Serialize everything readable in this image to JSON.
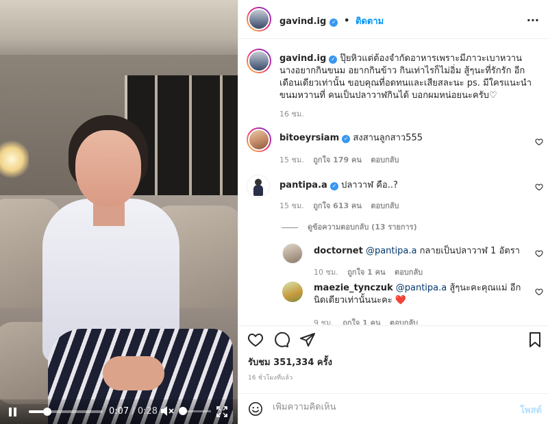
{
  "video": {
    "current_time": "0:07",
    "separator": "/",
    "duration": "0:28",
    "progress_fraction": 0.25,
    "volume_fraction": 0.0
  },
  "header": {
    "username": "gavind.ig",
    "separator": "•",
    "follow_label": "ติดตาม",
    "more_label": "···"
  },
  "caption": {
    "username": "gavind.ig",
    "text": "ปุ๊ยหิวแต่ต้องจำกัดอาหารเพราะมีภาวะเบาหวาน นางอยากกินขนม อยากกินข้าว กินเท่าไรก็ไม่อิ่ม สู้ๆนะที่รักรัก อีกเดือนเดียวเท่านั้น ขอบคุณที่อดทนและเสียสละนะ ps. มีใครแนะนำขนมหวานที่ คนเป็นปลาวาฬกินได้ บอกผมหน่อยนะครับ♡",
    "time": "16 ชม."
  },
  "comments": [
    {
      "username": "bitoeyrsiam",
      "verified": true,
      "text": "สงสานลูกสาว555",
      "time": "15 ชม.",
      "likes": "ถูกใจ 179 คน",
      "reply_label": "ตอบกลับ"
    },
    {
      "username": "pantipa.a",
      "verified": true,
      "text": "ปลาวาฬ คือ..?",
      "time": "15 ชม.",
      "likes": "ถูกใจ 613 คน",
      "reply_label": "ตอบกลับ"
    }
  ],
  "view_replies_label": "ดูข้อความตอบกลับ (13 รายการ)",
  "replies": [
    {
      "username": "doctornet",
      "mention": "@pantipa.a",
      "text": "กลายเป็นปลาวาฬ 1 อัตรา",
      "time": "10 ชม.",
      "likes": "ถูกใจ 1 คน",
      "reply_label": "ตอบกลับ"
    },
    {
      "username": "maezie_tynczuk",
      "mention": "@pantipa.a",
      "text": "สู้ๆนะคะคุณแม่ อีกนิดเดียวเท่านั้นนะคะ ❤️",
      "time": "9 ชม.",
      "likes": "ถูกใจ 1 คน",
      "reply_label": "ตอบกลับ"
    }
  ],
  "actions": {
    "likes_label": "รับชม 351,334 ครั้ง",
    "time_ago": "16 ชั่วโมงที่แล้ว"
  },
  "add_comment": {
    "placeholder": "เพิ่มความคิดเห็น",
    "post_label": "โพสต์"
  },
  "colors": {
    "accent": "#0095f6",
    "verified": "#3897f0",
    "text": "#262626",
    "muted": "#8e8e8e",
    "heart": "#ed4956"
  }
}
